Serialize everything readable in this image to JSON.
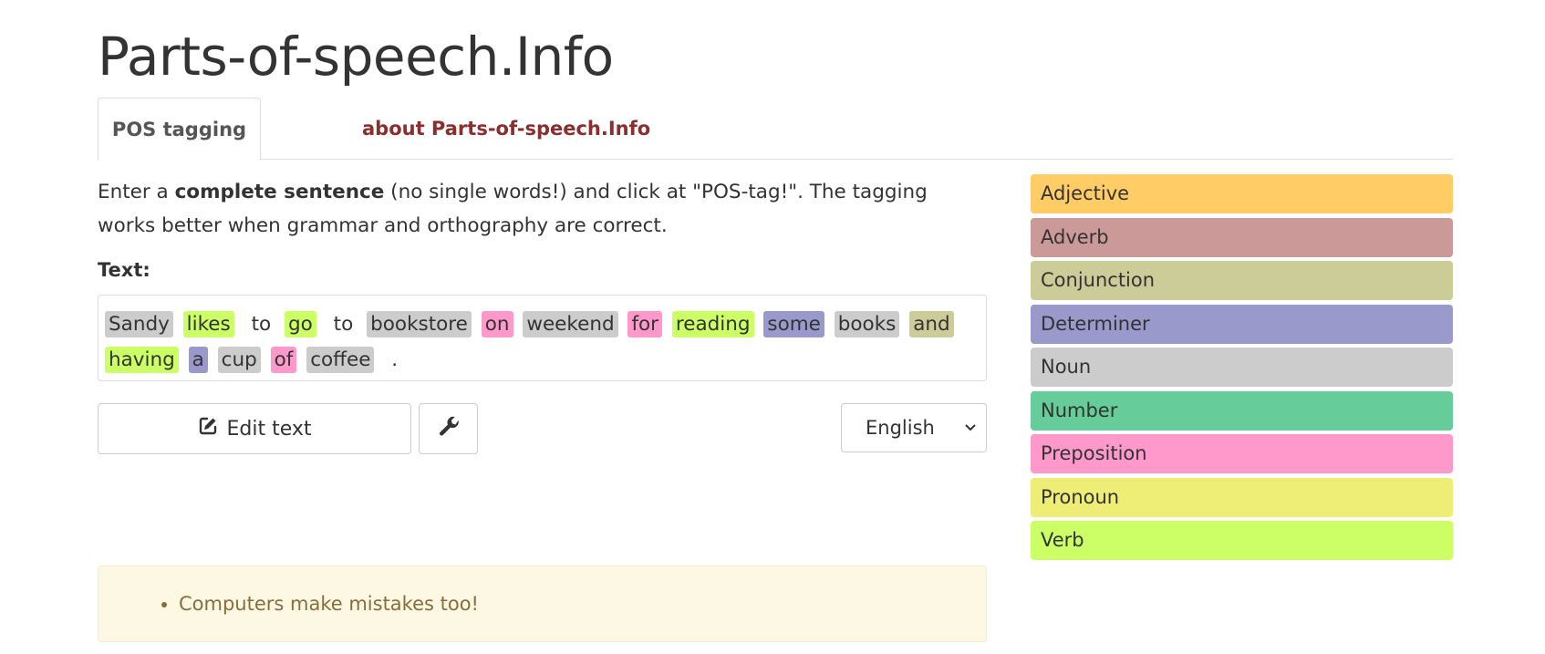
{
  "site_title": "Parts-of-speech.Info",
  "tabs": [
    {
      "label": "POS tagging"
    },
    {
      "label": "about Parts-of-speech.Info"
    }
  ],
  "intro": {
    "part1": "Enter a ",
    "bold": "complete sentence",
    "part2": " (no single words!) and click at \"POS-tag!\". The tagging works better when grammar and orthography are correct."
  },
  "text_label": "Text:",
  "tokens": [
    {
      "word": "Sandy",
      "pos": "noun"
    },
    {
      "word": "likes",
      "pos": "verb"
    },
    {
      "word": "to",
      "pos": "none"
    },
    {
      "word": "go",
      "pos": "verb"
    },
    {
      "word": "to",
      "pos": "none"
    },
    {
      "word": "bookstore",
      "pos": "noun"
    },
    {
      "word": "on",
      "pos": "preposition"
    },
    {
      "word": "weekend",
      "pos": "noun"
    },
    {
      "word": "for",
      "pos": "preposition"
    },
    {
      "word": "reading",
      "pos": "verb"
    },
    {
      "word": "some",
      "pos": "determiner"
    },
    {
      "word": "books",
      "pos": "noun"
    },
    {
      "word": "and",
      "pos": "conjunction"
    },
    {
      "word": "having",
      "pos": "verb"
    },
    {
      "word": "a",
      "pos": "determiner"
    },
    {
      "word": "cup",
      "pos": "noun"
    },
    {
      "word": "of",
      "pos": "preposition"
    },
    {
      "word": "coffee",
      "pos": "noun"
    },
    {
      "word": ".",
      "pos": "none"
    }
  ],
  "buttons": {
    "edit_label": "Edit text",
    "edit_icon": "edit-icon",
    "settings_icon": "wrench-icon"
  },
  "language_select": {
    "selected": "English"
  },
  "alert": {
    "items": [
      "Computers make mistakes too!"
    ]
  },
  "legend": [
    {
      "key": "adjective",
      "label": "Adjective",
      "color": "#ffcc66"
    },
    {
      "key": "adverb",
      "label": "Adverb",
      "color": "#cc9999"
    },
    {
      "key": "conjunction",
      "label": "Conjunction",
      "color": "#cccc99"
    },
    {
      "key": "determiner",
      "label": "Determiner",
      "color": "#9999cc"
    },
    {
      "key": "noun",
      "label": "Noun",
      "color": "#cccccc"
    },
    {
      "key": "number",
      "label": "Number",
      "color": "#66cc99"
    },
    {
      "key": "preposition",
      "label": "Preposition",
      "color": "#ff99cc"
    },
    {
      "key": "pronoun",
      "label": "Pronoun",
      "color": "#eeee77"
    },
    {
      "key": "verb",
      "label": "Verb",
      "color": "#ccff66"
    }
  ]
}
